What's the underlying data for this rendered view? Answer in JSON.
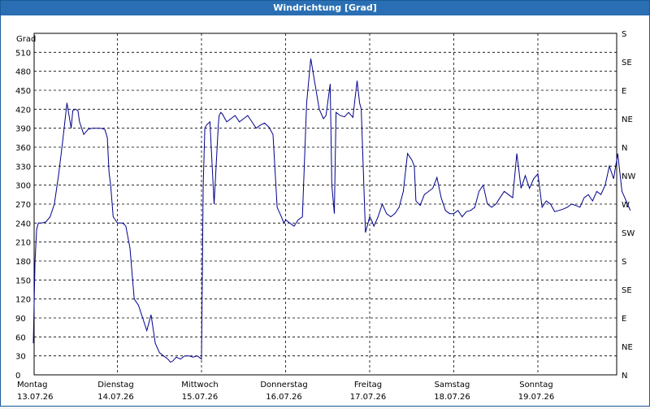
{
  "window": {
    "title": "Windrichtung [Grad]"
  },
  "chart_data": {
    "type": "line",
    "title": "Windrichtung [Grad]",
    "ylabel": "Grad",
    "ylim": [
      0,
      540
    ],
    "y_ticks": [
      0,
      30,
      60,
      90,
      120,
      150,
      180,
      210,
      240,
      270,
      300,
      330,
      360,
      390,
      420,
      450,
      480,
      510
    ],
    "right_axis_labels": [
      "N",
      "NE",
      "E",
      "SE",
      "S",
      "SW",
      "W",
      "NW",
      "N",
      "NE",
      "E",
      "SE",
      "S"
    ],
    "x_categories": [
      {
        "day": "Montag",
        "date": "13.07.26"
      },
      {
        "day": "Dienstag",
        "date": "14.07.26"
      },
      {
        "day": "Mittwoch",
        "date": "15.07.26"
      },
      {
        "day": "Donnerstag",
        "date": "16.07.26"
      },
      {
        "day": "Freitag",
        "date": "17.07.26"
      },
      {
        "day": "Samstag",
        "date": "18.07.26"
      },
      {
        "day": "Sonntag",
        "date": "19.07.26"
      }
    ],
    "grid": true,
    "line_color": "#00008b",
    "series": [
      {
        "x_days": [
          0,
          0.02,
          0.04,
          0.06,
          0.1,
          0.15,
          0.2,
          0.25,
          0.3,
          0.35,
          0.4,
          0.45,
          0.47,
          0.5,
          0.53,
          0.55,
          0.6,
          0.65,
          0.7,
          0.75,
          0.8,
          0.85,
          0.88,
          0.9,
          0.92,
          0.95,
          1.0,
          1.04,
          1.06,
          1.08,
          1.1,
          1.15,
          1.2,
          1.25,
          1.3,
          1.35,
          1.4,
          1.45,
          1.5,
          1.55,
          1.6,
          1.63,
          1.66,
          1.7,
          1.75,
          1.8,
          1.85,
          1.9,
          1.95,
          2.0,
          2.02,
          2.04,
          2.06,
          2.1,
          2.15,
          2.2,
          2.21,
          2.23,
          2.25,
          2.3,
          2.35,
          2.4,
          2.45,
          2.5,
          2.55,
          2.6,
          2.65,
          2.7,
          2.75,
          2.8,
          2.85,
          2.9,
          2.95,
          2.98,
          3.0,
          3.05,
          3.1,
          3.15,
          3.2,
          3.25,
          3.3,
          3.35,
          3.4,
          3.45,
          3.48,
          3.5,
          3.53,
          3.55,
          3.58,
          3.6,
          3.65,
          3.7,
          3.75,
          3.8,
          3.85,
          3.88,
          3.9,
          3.95,
          4.0,
          4.02,
          4.05,
          4.1,
          4.15,
          4.2,
          4.25,
          4.3,
          4.35,
          4.4,
          4.42,
          4.45,
          4.5,
          4.53,
          4.55,
          4.6,
          4.65,
          4.7,
          4.75,
          4.8,
          4.85,
          4.9,
          4.95,
          5.0,
          5.05,
          5.1,
          5.15,
          5.2,
          5.25,
          5.3,
          5.35,
          5.4,
          5.45,
          5.5,
          5.55,
          5.6,
          5.65,
          5.7,
          5.75,
          5.8,
          5.85,
          5.9,
          5.95,
          6.0,
          6.05,
          6.1,
          6.15,
          6.2,
          6.25,
          6.3,
          6.35,
          6.4,
          6.45,
          6.5,
          6.55,
          6.6,
          6.65,
          6.7,
          6.75,
          6.8,
          6.85,
          6.9,
          6.95,
          7.0,
          7.05,
          7.1
        ],
        "values": [
          50,
          180,
          230,
          240,
          240,
          242,
          250,
          270,
          315,
          370,
          430,
          390,
          418,
          420,
          418,
          400,
          380,
          388,
          390,
          390,
          390,
          388,
          375,
          320,
          300,
          250,
          240,
          240,
          240,
          238,
          235,
          200,
          120,
          110,
          90,
          70,
          95,
          50,
          35,
          30,
          25,
          20,
          22,
          28,
          25,
          30,
          30,
          28,
          30,
          25,
          300,
          390,
          395,
          400,
          270,
          395,
          410,
          415,
          412,
          400,
          405,
          410,
          400,
          405,
          410,
          400,
          390,
          395,
          398,
          392,
          380,
          265,
          250,
          240,
          245,
          240,
          235,
          245,
          250,
          430,
          500,
          460,
          420,
          405,
          410,
          430,
          460,
          300,
          255,
          415,
          410,
          408,
          415,
          407,
          465,
          430,
          420,
          225,
          250,
          245,
          235,
          250,
          270,
          255,
          250,
          255,
          265,
          290,
          315,
          350,
          340,
          330,
          275,
          268,
          285,
          290,
          295,
          312,
          280,
          260,
          255,
          255,
          260,
          250,
          258,
          260,
          265,
          290,
          300,
          270,
          265,
          270,
          280,
          290,
          285,
          280,
          350,
          295,
          315,
          295,
          310,
          318,
          265,
          275,
          270,
          258,
          260,
          262,
          265,
          270,
          268,
          265,
          280,
          285,
          275,
          290,
          285,
          300,
          330,
          310,
          350,
          290,
          275,
          260,
          255
        ]
      }
    ]
  }
}
